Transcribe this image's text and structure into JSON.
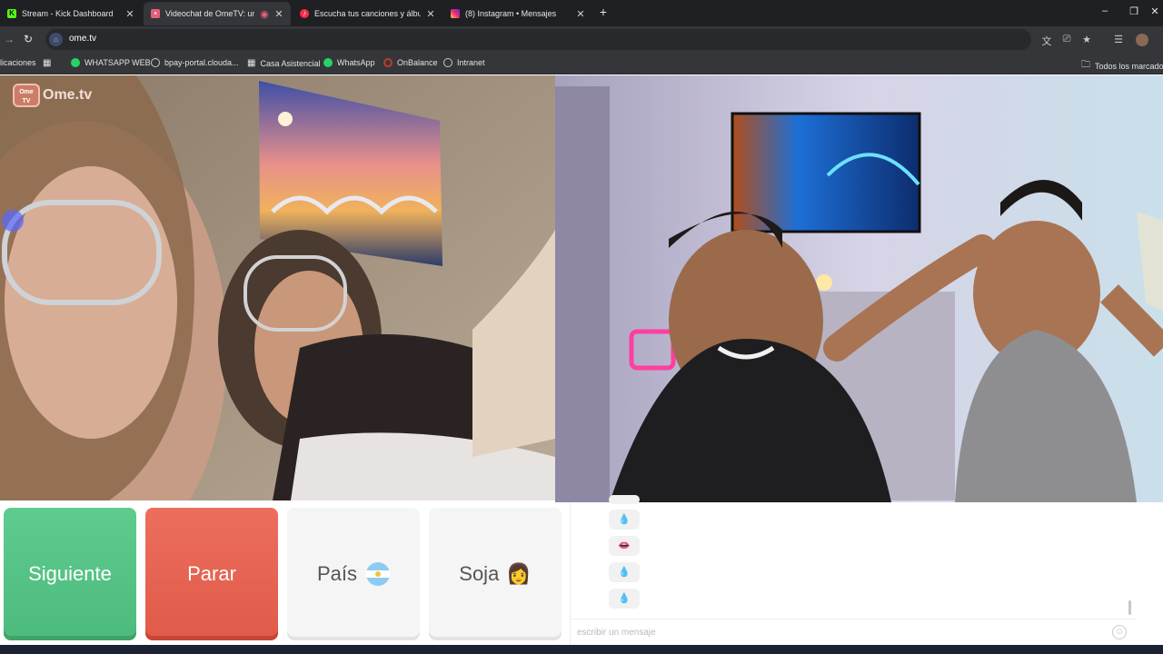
{
  "browser": {
    "tabs": [
      {
        "title": "Stream - Kick Dashboard",
        "favicon": "kick-icon",
        "color": "#53fc18",
        "active": false
      },
      {
        "title": "Videochat de OmeTV: una al",
        "favicon": "ometv-icon",
        "color": "#e6607a",
        "active": true
      },
      {
        "title": "Escucha tus canciones y álbumes",
        "favicon": "music-icon",
        "color": "#fa2d48",
        "active": false
      },
      {
        "title": "(8) Instagram • Mensajes",
        "favicon": "instagram-icon",
        "color": "#c13584",
        "active": false
      }
    ],
    "new_tab": "+",
    "window_controls": {
      "minimize": "–",
      "restore": "❐",
      "close": "✕"
    },
    "url": "ome.tv",
    "bookmarks": [
      {
        "label": "licaciones",
        "icon": "apps-icon"
      },
      {
        "label": "",
        "icon": "grid-icon"
      },
      {
        "label": "WHATSAPP WEB",
        "icon": "whatsapp-icon",
        "color": "#25d366"
      },
      {
        "label": "bpay-portal.clouda...",
        "icon": "globe-icon",
        "color": "#9aa0a6"
      },
      {
        "label": "Casa Asistencial",
        "icon": "grid-icon",
        "color": "#e3e3e3"
      },
      {
        "label": "WhatsApp",
        "icon": "whatsapp-icon",
        "color": "#25d366"
      },
      {
        "label": "OnBalance",
        "icon": "onbalance-icon",
        "color": "#c0392b"
      },
      {
        "label": "Intranet",
        "icon": "globe-icon",
        "color": "#9aa0a6"
      }
    ],
    "all_bookmarks": "Todos los marcadores"
  },
  "logo": {
    "badge": "Ome TV",
    "text": "Ome.tv"
  },
  "controls": {
    "next_label": "Siguiente",
    "stop_label": "Parar",
    "country_label": "País",
    "country_flag": "argentina-flag-icon",
    "gender_label": "Soja",
    "gender_icon": "👩"
  },
  "chat": {
    "messages": [
      "💧",
      "👄",
      "💧",
      "💧"
    ],
    "input_placeholder": "escribir un mensaje",
    "emoji_button": "☺"
  },
  "colors": {
    "next": "#53c285",
    "stop": "#e5604f",
    "browser_bg": "#35363a"
  }
}
